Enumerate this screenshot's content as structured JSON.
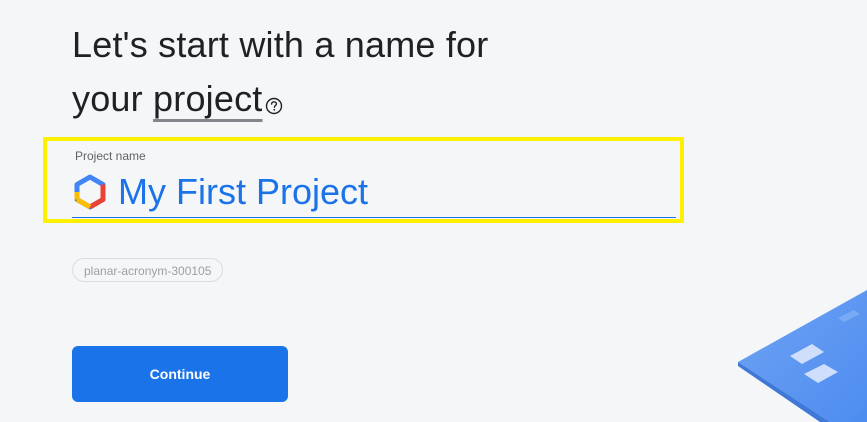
{
  "heading": {
    "line1": "Let's start with a name for",
    "line2_prefix": "your ",
    "line2_link": "project"
  },
  "project_field": {
    "label": "Project name",
    "value": "My First Project"
  },
  "project_id_chip": "planar-acronym-300105",
  "continue_button": "Continue",
  "colors": {
    "accent": "#1a73e8",
    "highlight": "#ffef00",
    "background": "#f5f6f8"
  },
  "icons": {
    "help": "help-circle-icon",
    "logo": "google-cloud-hexagon-logo",
    "decor": "isometric-blue-tiles-illustration"
  }
}
